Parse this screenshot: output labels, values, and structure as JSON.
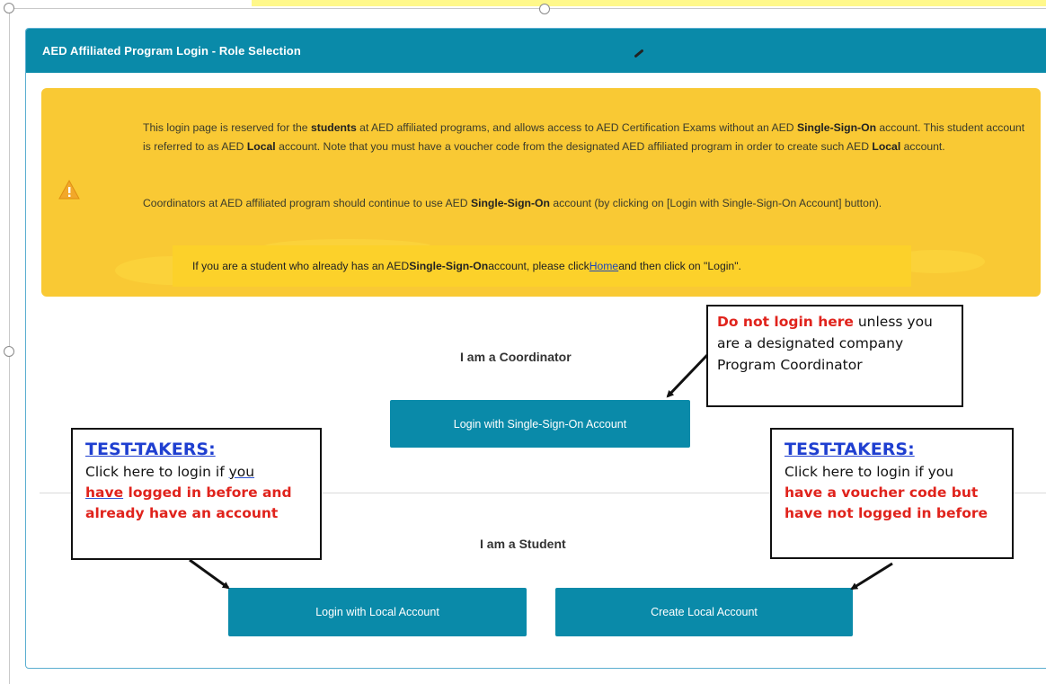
{
  "panel": {
    "title": "AED Affiliated Program Login - Role Selection"
  },
  "alert": {
    "p1": [
      {
        "t": "This login page is reserved for the ",
        "b": false
      },
      {
        "t": "students",
        "b": true
      },
      {
        "t": " at AED affiliated programs, and allows access to AED Certification Exams without an AED ",
        "b": false
      },
      {
        "t": "Single-Sign-On",
        "b": true
      },
      {
        "t": " account. This student account is referred to as AED ",
        "b": false
      },
      {
        "t": "Local",
        "b": true
      },
      {
        "t": " account. Note that you must have a voucher code from the designated AED affiliated program in order to create such AED ",
        "b": false
      },
      {
        "t": "Local",
        "b": true
      },
      {
        "t": " account.",
        "b": false
      }
    ],
    "p2": [
      {
        "t": "Coordinators at AED affiliated program should continue to use AED ",
        "b": false
      },
      {
        "t": "Single-Sign-On",
        "b": true
      },
      {
        "t": " account (by clicking on [Login with Single-Sign-On Account] button).",
        "b": false
      }
    ],
    "note": {
      "before": "If you are a student who already has an AED ",
      "bold": "Single-Sign-On",
      "middle": " account, please click ",
      "link": "Home",
      "after": " and then click on \"Login\"."
    },
    "icon": "warning-icon"
  },
  "coordinator": {
    "heading": "I am a Coordinator",
    "button": "Login with Single-Sign-On Account"
  },
  "student": {
    "heading": "I am a Student",
    "login_button": "Login with Local Account",
    "create_button": "Create Local Account"
  },
  "callouts": {
    "coordinator": {
      "red": "Do not login here",
      "rest": " unless you are a designated company Program Coordinator"
    },
    "left": {
      "title": "TEST-TAKERS:",
      "line1_a": "Click here to login if ",
      "line1_b": "you ",
      "line2_a": "have",
      "line2_b": " logged in before and",
      "line3": "already have an  account"
    },
    "right": {
      "title": "TEST-TAKERS:",
      "line1": "Click here to login if you",
      "line2": "have a voucher code but",
      "line3": "have not logged in before"
    }
  },
  "colors": {
    "header": "#0a8aa9",
    "alert": "#f9c934",
    "button": "#0a8aa9",
    "callout_red": "#e0231c",
    "callout_blue": "#1f3fd0"
  }
}
